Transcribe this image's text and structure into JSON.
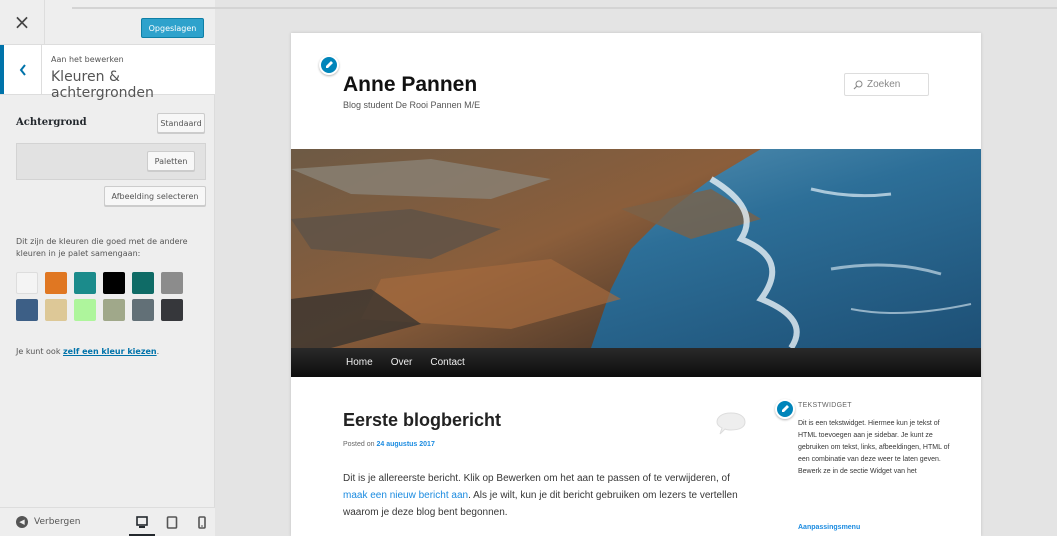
{
  "header": {
    "close_glyph": "×",
    "save_label": "Opgeslagen"
  },
  "section": {
    "editing_label": "Aan het bewerken",
    "title": "Kleuren & achtergronden"
  },
  "background_control": {
    "label": "Achtergrond",
    "default_button": "Standaard",
    "palettes_button": "Paletten",
    "select_image_button": "Afbeelding selecteren"
  },
  "palette": {
    "note": "Dit zijn de kleuren die goed met de andere kleuren in je palet samengaan:",
    "colors": [
      "#f4f4f4",
      "#e07722",
      "#1b8b8b",
      "#000000",
      "#0f6b66",
      "#8c8c8c",
      "#3d5f86",
      "#ddc897",
      "#aef59c",
      "#a0a88a",
      "#627077",
      "#36373b"
    ],
    "custom_prefix": "Je kunt ook",
    "custom_link": "zelf een kleur kiezen",
    "custom_suffix": "."
  },
  "footer": {
    "hide_label": "Verbergen",
    "devices": [
      "desktop-icon",
      "tablet-icon",
      "mobile-icon"
    ]
  },
  "site": {
    "title": "Anne Pannen",
    "description": "Blog student De Rooi Pannen M/E",
    "search_placeholder": "Zoeken",
    "menu": [
      "Home",
      "Over",
      "Contact"
    ]
  },
  "post": {
    "title": "Eerste blogbericht",
    "posted_on": "Posted on",
    "date": "24 augustus 2017",
    "body_part1": "Dit is je allereerste bericht. Klik op Bewerken om het aan te passen of te verwijderen, of",
    "body_link": "maak een nieuw bericht aan",
    "body_part2": ". Als je wilt, kun je dit bericht gebruiken om lezers te vertellen waarom je deze blog bent begonnen."
  },
  "widget": {
    "title": "TEKSTWIDGET",
    "text": "Dit is een tekstwidget. Hiermee kun je tekst of HTML toevoegen aan je sidebar. Je kunt ze gebruiken om tekst, links, afbeeldingen, HTML of een combinatie van deze weer te laten geven. Bewerk ze in de sectie Widget van het",
    "link": "Aanpassingsmenu"
  },
  "colors": {
    "accent": "#0073aa",
    "save_button": "#2ea2cc",
    "link": "#1b8be0"
  }
}
